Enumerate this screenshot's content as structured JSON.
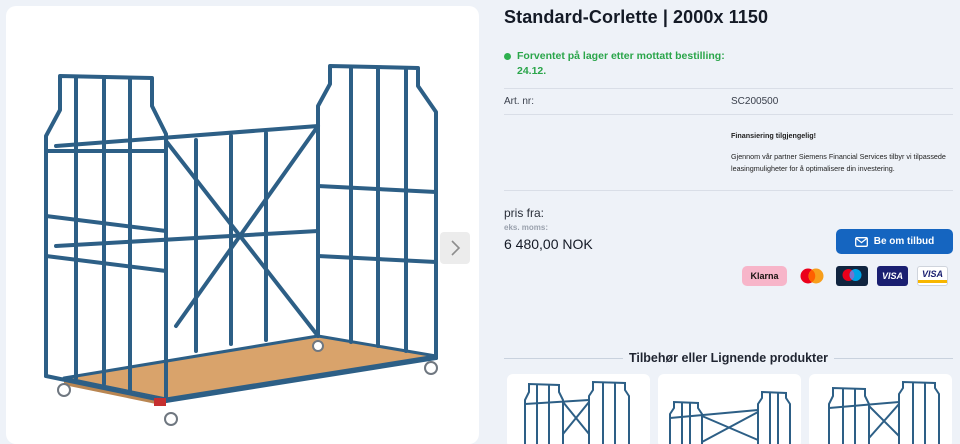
{
  "product": {
    "title": "Standard-Corlette | 2000x 1150",
    "stock_text": "Forventet på lager etter mottatt bestilling: 24.12.",
    "stock_color": "#2eb04f",
    "art_label": "Art. nr:",
    "art_value": "SC200500"
  },
  "financing": {
    "heading": "Finansiering tilgjengelig!",
    "body": "Gjennom vår partner Siemens Financial Services tilbyr vi tilpassede leasingmuligheter for å optimalisere din investering."
  },
  "pricing": {
    "from_label": "pris fra:",
    "ex_vat_label": "eks. moms:",
    "price": "6 480,00 NOK"
  },
  "quote_button": {
    "label": "Be om tilbud",
    "icon": "envelope-icon",
    "color": "#1565c0"
  },
  "payment_methods": [
    {
      "name": "Klarna",
      "label": "Klarna"
    },
    {
      "name": "Mastercard",
      "label": ""
    },
    {
      "name": "Maestro",
      "label": ""
    },
    {
      "name": "Visa",
      "label": "VISA"
    },
    {
      "name": "Visa Electron",
      "label": "VISA"
    }
  ],
  "gallery": {
    "next_icon": "chevron-right-icon"
  },
  "related": {
    "title": "Tilbehør eller Lignende produkter",
    "cards": [
      {
        "image": "cart-thumbnail-1"
      },
      {
        "image": "cart-thumbnail-2"
      },
      {
        "image": "cart-thumbnail-3"
      }
    ]
  }
}
